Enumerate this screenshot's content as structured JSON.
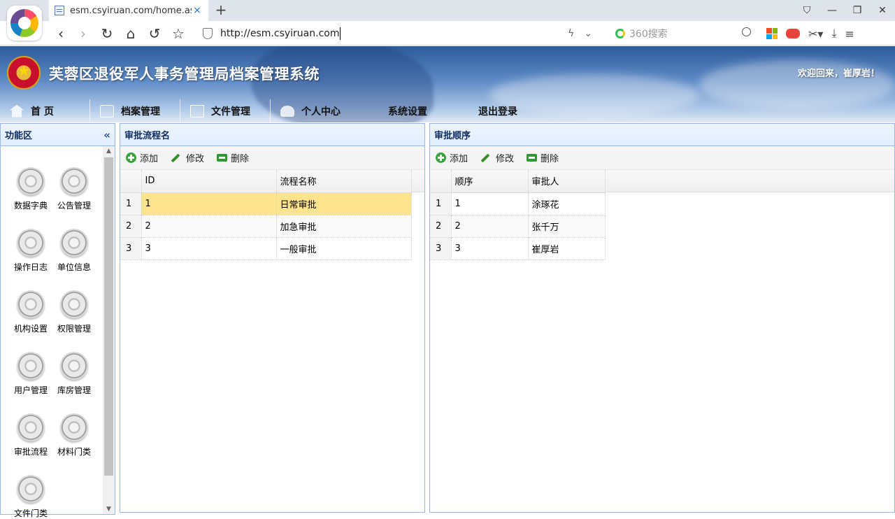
{
  "browser": {
    "tab_title": "esm.csyiruan.com/home.aspx",
    "tab_close": "×",
    "new_tab": "+",
    "url": "http://esm.csyiruan.com",
    "search_placeholder": "360搜索",
    "icons": [
      "back-icon",
      "forward-icon",
      "refresh-icon",
      "home-icon",
      "undo-icon",
      "star-icon",
      "shield-icon",
      "lightning-icon",
      "dropdown-icon",
      "search-icon",
      "apps-icon",
      "game-icon",
      "scissors-icon",
      "download-icon",
      "menu-icon"
    ]
  },
  "header": {
    "title": "芙蓉区退役军人事务管理局档案管理系统",
    "welcome": "欢迎回来，崔厚岩！",
    "menu": [
      {
        "label": "首 页",
        "icon": "home-icon"
      },
      {
        "label": "档案管理",
        "icon": "bag-icon"
      },
      {
        "label": "文件管理",
        "icon": "document-icon"
      },
      {
        "label": "个人中心",
        "icon": "person-icon"
      },
      {
        "label": "系统设置",
        "icon": ""
      },
      {
        "label": "退出登录",
        "icon": ""
      }
    ]
  },
  "sidebar": {
    "title": "功能区",
    "collapse": "«",
    "items": [
      {
        "label": "数据字典"
      },
      {
        "label": "公告管理"
      },
      {
        "label": "操作日志"
      },
      {
        "label": "单位信息"
      },
      {
        "label": "机构设置"
      },
      {
        "label": "权限管理"
      },
      {
        "label": "用户管理"
      },
      {
        "label": "库房管理"
      },
      {
        "label": "审批流程"
      },
      {
        "label": "材料门类"
      },
      {
        "label": "文件门类"
      }
    ]
  },
  "left_panel": {
    "title": "审批流程名",
    "toolbar": {
      "add": "添加",
      "edit": "修改",
      "delete": "删除"
    },
    "columns": [
      "ID",
      "流程名称"
    ],
    "rows": [
      {
        "rn": "1",
        "id": "1",
        "name": "日常审批"
      },
      {
        "rn": "2",
        "id": "2",
        "name": "加急审批"
      },
      {
        "rn": "3",
        "id": "3",
        "name": "一般审批"
      }
    ],
    "selected_row": 1
  },
  "right_panel": {
    "title": "审批顺序",
    "toolbar": {
      "add": "添加",
      "edit": "修改",
      "delete": "删除"
    },
    "columns": [
      "顺序",
      "审批人"
    ],
    "rows": [
      {
        "rn": "1",
        "order": "1",
        "approver": "涂琢花"
      },
      {
        "rn": "2",
        "order": "2",
        "approver": "张千万"
      },
      {
        "rn": "3",
        "order": "3",
        "approver": "崔厚岩"
      }
    ]
  },
  "colors": {
    "panel_border": "#95b8e7",
    "selected_row": "#ffe48d",
    "header_title": "#0e2d5f"
  }
}
